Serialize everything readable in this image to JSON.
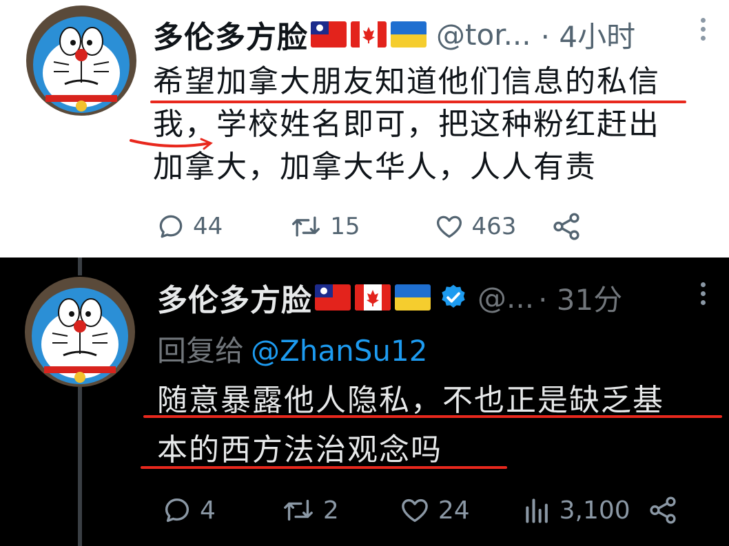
{
  "tweet_top": {
    "author_name": "多伦多方脸",
    "handle": "@tor...",
    "time": "· 4小时",
    "lines": [
      "希望加拿大朋友知道他们信息的私信",
      "我，学校姓名即可，把这种粉红赶出",
      "加拿大，加拿大华人，人人有责"
    ],
    "reply_count": "44",
    "retweet_count": "15",
    "like_count": "463"
  },
  "tweet_bottom": {
    "author_name": "多伦多方脸",
    "handle": "@...",
    "time": "· 31分",
    "reply_label": "回复给",
    "reply_mention": "@ZhanSu12",
    "lines": [
      "随意暴露他人隐私，不也正是缺乏基",
      "本的西方法治观念吗"
    ],
    "reply_count": "4",
    "retweet_count": "2",
    "like_count": "24",
    "view_count": "3,100"
  },
  "colors": {
    "annotation_red": "#e8281d",
    "verified_blue": "#1d9bf0",
    "dark_bg": "#000000",
    "light_bg": "#ffffff"
  },
  "icons": [
    "more-icon",
    "reply-icon",
    "retweet-icon",
    "like-icon",
    "share-icon",
    "views-icon",
    "verified-icon",
    "flag-taiwan-icon",
    "flag-canada-icon",
    "flag-ukraine-icon"
  ]
}
